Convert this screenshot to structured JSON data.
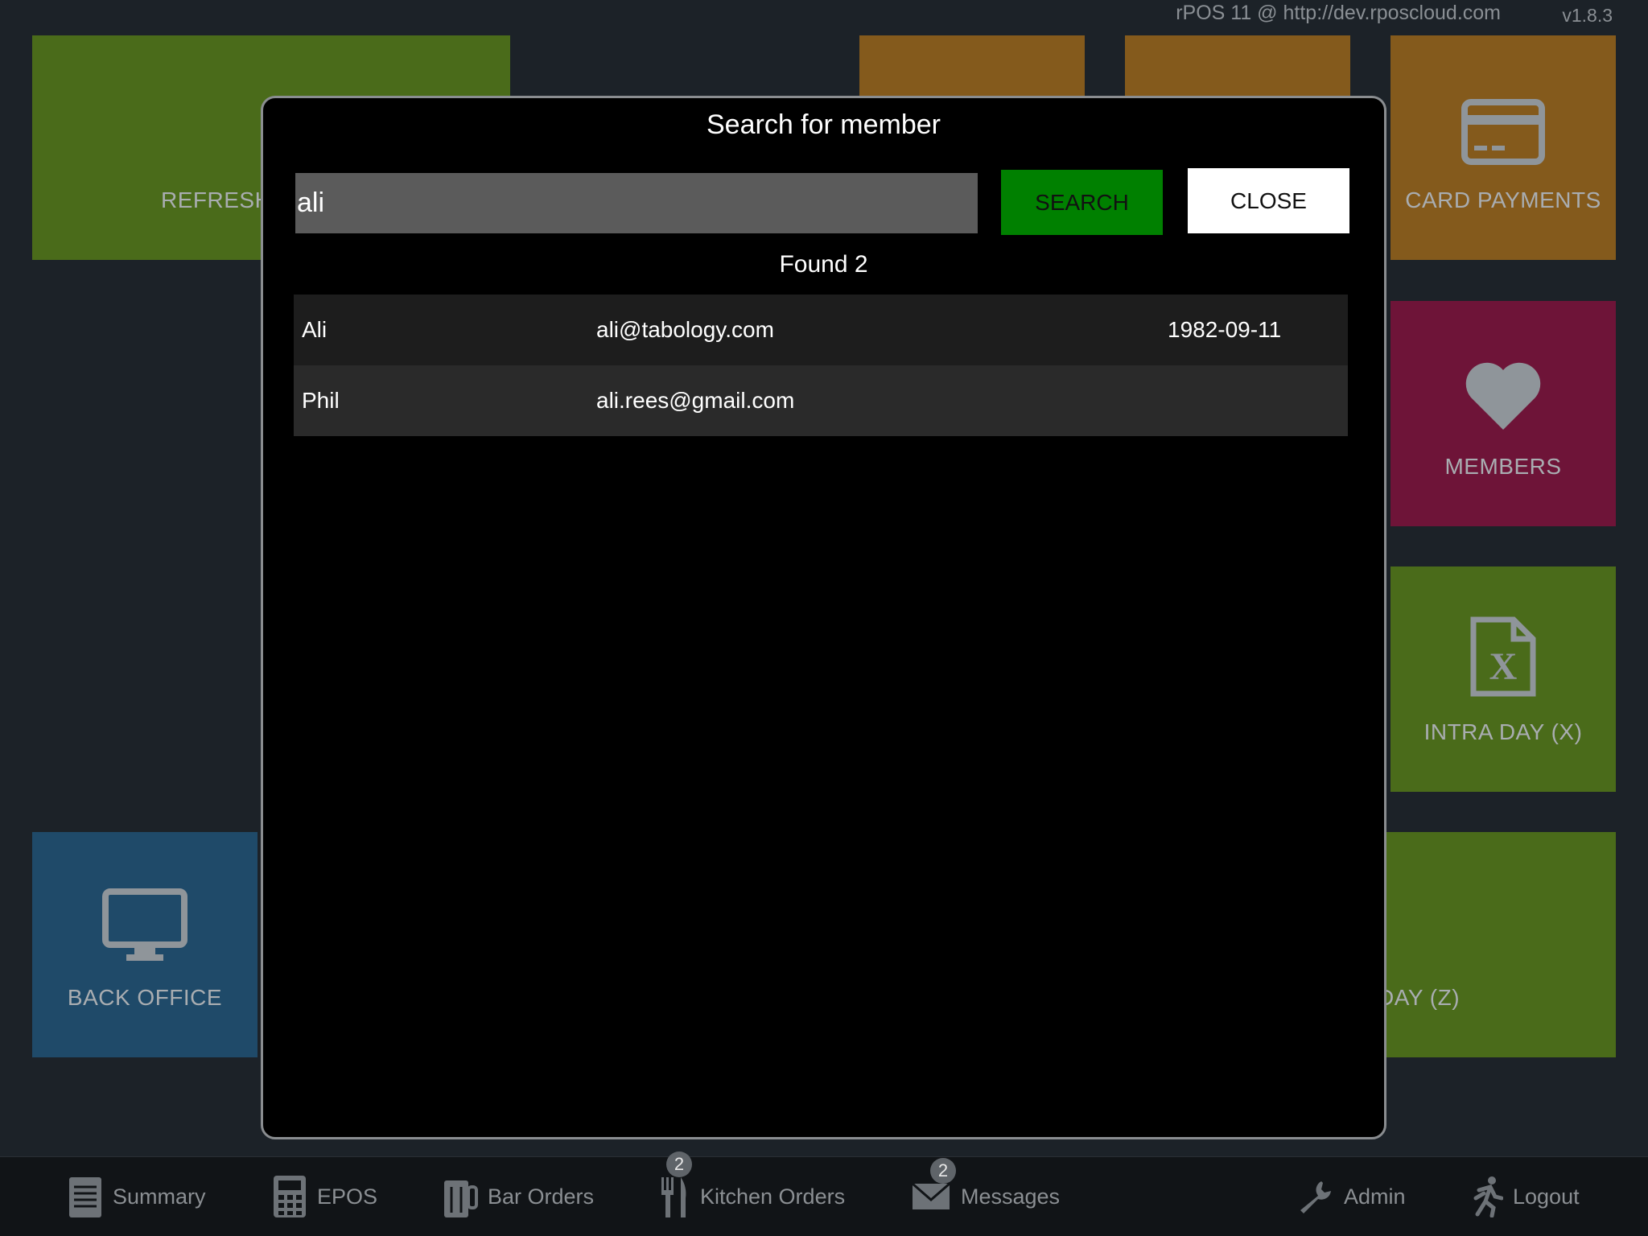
{
  "header": {
    "server": "rPOS 11 @ http://dev.rposcloud.com",
    "version": "v1.8.3"
  },
  "tiles": {
    "refresh": {
      "label": "REFRESH",
      "color": "#4a6b1a",
      "icon": "refresh-icon"
    },
    "orange1": {
      "label": "",
      "color": "#845a1c",
      "icon": "user-icon"
    },
    "orange2": {
      "label": "",
      "color": "#845a1c",
      "icon": "document-icon"
    },
    "card_payments": {
      "label": "CARD PAYMENTS",
      "color": "#845a1c",
      "icon": "credit-card-icon"
    },
    "members": {
      "label": "MEMBERS",
      "color": "#6e1438",
      "icon": "heart-icon"
    },
    "intra_day": {
      "label": "INTRA DAY (X)",
      "color": "#4a6b1a",
      "icon": "file-x-icon"
    },
    "back_office": {
      "label": "BACK OFFICE",
      "color": "#1f4a69",
      "icon": "monitor-icon"
    },
    "end_day": {
      "label": "DAY (Z)",
      "color": "#4a6b1a",
      "icon": "database-icon"
    }
  },
  "modal": {
    "title": "Search for member",
    "search_value": "ali",
    "search_label": "SEARCH",
    "close_label": "CLOSE",
    "found_text": "Found 2",
    "results": [
      {
        "name": "Ali",
        "email": "ali@tabology.com",
        "dob": "1982-09-11"
      },
      {
        "name": "Phil",
        "email": "ali.rees@gmail.com",
        "dob": ""
      }
    ]
  },
  "bottom_nav": {
    "summary": "Summary",
    "epos": "EPOS",
    "bar_orders": "Bar Orders",
    "kitchen_orders": "Kitchen Orders",
    "kitchen_badge": "2",
    "messages": "Messages",
    "messages_badge": "2",
    "admin": "Admin",
    "logout": "Logout"
  }
}
